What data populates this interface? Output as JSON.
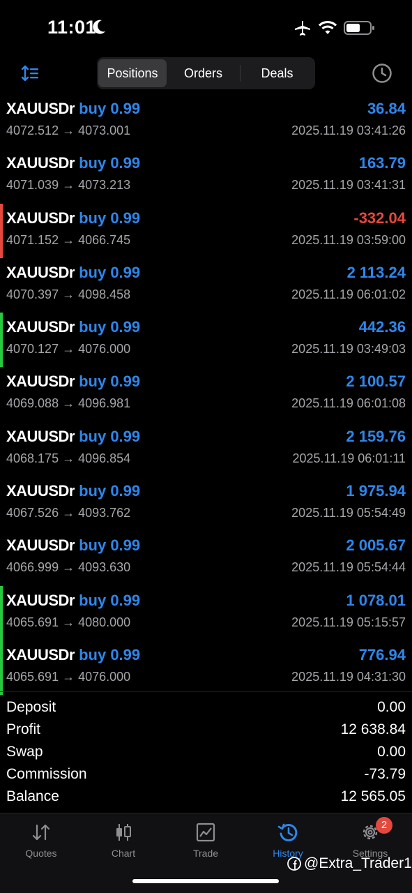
{
  "status_bar": {
    "time": "11:01"
  },
  "toolbar": {
    "segments": [
      "Positions",
      "Orders",
      "Deals"
    ],
    "active_segment": "Positions"
  },
  "positions": [
    {
      "symbol": "XAUUSDr",
      "side_volume": "buy 0.99",
      "prices": "4072.512 → 4073.001",
      "profit": "36.84",
      "time": "2025.11.19 03:41:26",
      "profit_color": "#2f86ea",
      "marker": ""
    },
    {
      "symbol": "XAUUSDr",
      "side_volume": "buy 0.99",
      "prices": "4071.039 → 4073.213",
      "profit": "163.79",
      "time": "2025.11.19 03:41:31",
      "profit_color": "#2f86ea",
      "marker": ""
    },
    {
      "symbol": "XAUUSDr",
      "side_volume": "buy 0.99",
      "prices": "4071.152 → 4066.745",
      "profit": "-332.04",
      "time": "2025.11.19 03:59:00",
      "profit_color": "#e5483d",
      "marker": "#e5483d"
    },
    {
      "symbol": "XAUUSDr",
      "side_volume": "buy 0.99",
      "prices": "4070.397 → 4098.458",
      "profit": "2 113.24",
      "time": "2025.11.19 06:01:02",
      "profit_color": "#2f86ea",
      "marker": ""
    },
    {
      "symbol": "XAUUSDr",
      "side_volume": "buy 0.99",
      "prices": "4070.127 → 4076.000",
      "profit": "442.36",
      "time": "2025.11.19 03:49:03",
      "profit_color": "#2f86ea",
      "marker": "#27c93f"
    },
    {
      "symbol": "XAUUSDr",
      "side_volume": "buy 0.99",
      "prices": "4069.088 → 4096.981",
      "profit": "2 100.57",
      "time": "2025.11.19 06:01:08",
      "profit_color": "#2f86ea",
      "marker": ""
    },
    {
      "symbol": "XAUUSDr",
      "side_volume": "buy 0.99",
      "prices": "4068.175 → 4096.854",
      "profit": "2 159.76",
      "time": "2025.11.19 06:01:11",
      "profit_color": "#2f86ea",
      "marker": ""
    },
    {
      "symbol": "XAUUSDr",
      "side_volume": "buy 0.99",
      "prices": "4067.526 → 4093.762",
      "profit": "1 975.94",
      "time": "2025.11.19 05:54:49",
      "profit_color": "#2f86ea",
      "marker": ""
    },
    {
      "symbol": "XAUUSDr",
      "side_volume": "buy 0.99",
      "prices": "4066.999 → 4093.630",
      "profit": "2 005.67",
      "time": "2025.11.19 05:54:44",
      "profit_color": "#2f86ea",
      "marker": ""
    },
    {
      "symbol": "XAUUSDr",
      "side_volume": "buy 0.99",
      "prices": "4065.691 → 4080.000",
      "profit": "1 078.01",
      "time": "2025.11.19 05:15:57",
      "profit_color": "#2f86ea",
      "marker": "#27c93f"
    },
    {
      "symbol": "XAUUSDr",
      "side_volume": "buy 0.99",
      "prices": "4065.691 → 4076.000",
      "profit": "776.94",
      "time": "2025.11.19 04:31:30",
      "profit_color": "#2f86ea",
      "marker": "#27c93f"
    }
  ],
  "summary": [
    {
      "label": "Deposit",
      "value": "0.00"
    },
    {
      "label": "Profit",
      "value": "12 638.84"
    },
    {
      "label": "Swap",
      "value": "0.00"
    },
    {
      "label": "Commission",
      "value": "-73.79"
    },
    {
      "label": "Balance",
      "value": "12 565.05"
    }
  ],
  "tabs": [
    {
      "label": "Quotes",
      "icon": "quotes-arrows-icon"
    },
    {
      "label": "Chart",
      "icon": "candlestick-chart-icon"
    },
    {
      "label": "Trade",
      "icon": "trade-chart-icon"
    },
    {
      "label": "History",
      "icon": "history-clock-icon",
      "active": true
    },
    {
      "label": "Settings",
      "icon": "gear-icon",
      "badge": "2"
    }
  ],
  "watermark": "@Extra_Trader1",
  "colors": {
    "accent": "#2f86ea",
    "loss": "#e5483d",
    "marker_green": "#27c93f"
  }
}
